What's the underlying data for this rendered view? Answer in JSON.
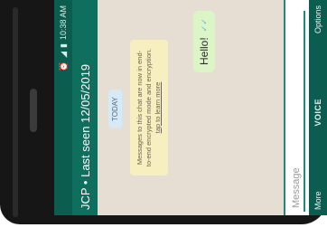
{
  "status": {
    "time": "10:38 AM",
    "icons": [
      "alarm-icon",
      "signal-icon",
      "battery-icon"
    ]
  },
  "header": {
    "title": "JCP • Last seen 12/05/2019"
  },
  "chat": {
    "date_label": "TODAY",
    "notice_text": "Messages to this chat are now in end-to-end encrypted mode and encryption.",
    "notice_link": "tap to learn more",
    "message_text": "Hello!"
  },
  "input": {
    "placeholder": "Message"
  },
  "softkeys": {
    "left": "More",
    "center": "VOICE",
    "right": "Options"
  },
  "colors": {
    "header": "#0e6f5e",
    "statusbar": "#0b5d4f",
    "chat_bg": "#e7ded3",
    "bubble_out": "#dcf5c6",
    "notice_bg": "#f7efc0"
  }
}
